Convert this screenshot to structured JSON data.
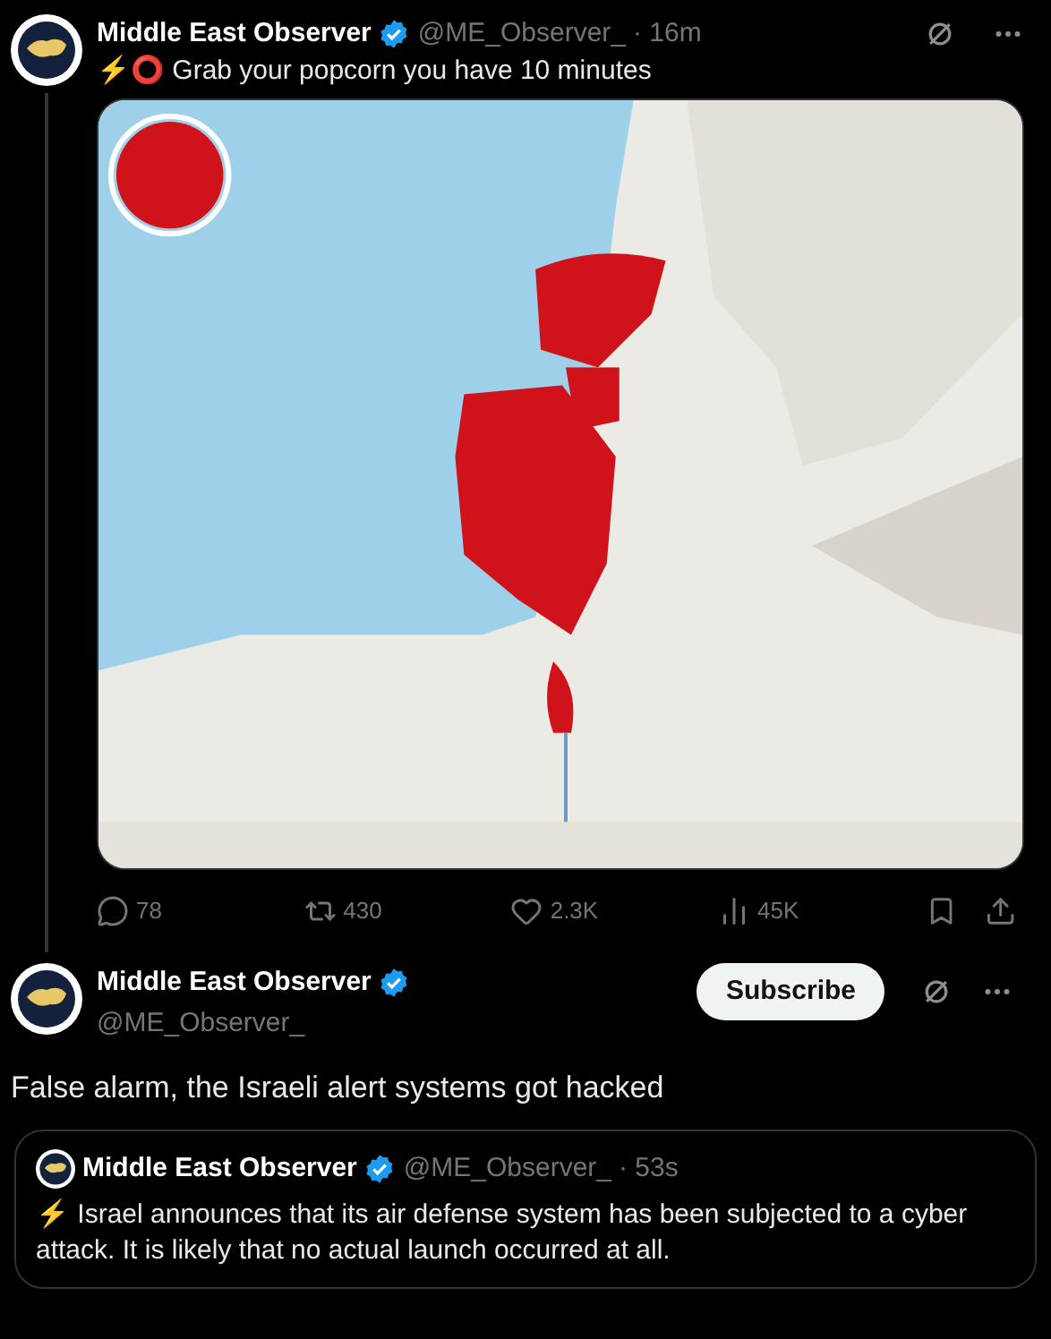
{
  "post": {
    "name": "Middle East Observer",
    "handle": "@ME_Observer_",
    "time": "· 16m",
    "verified": true,
    "text": "⚡⭕ Grab your popcorn you have 10 minutes",
    "actions": [
      {
        "kind": "reply",
        "count": "78"
      },
      {
        "kind": "repost",
        "count": "430"
      },
      {
        "kind": "like",
        "count": "2.3K"
      },
      {
        "kind": "views",
        "count": "45K"
      }
    ]
  },
  "reply": {
    "name": "Middle East Observer",
    "handle": "@ME_Observer_",
    "verified": true,
    "subscribe": "Subscribe",
    "text": "False alarm, the Israeli alert systems got hacked",
    "quote": {
      "name": "Middle East Observer",
      "handle": "@ME_Observer_",
      "time": "· 53s",
      "verified": true,
      "text": "⚡ Israel announces that its air defense system has been subjected to a cyber attack. It is likely that no actual launch occurred at all."
    }
  }
}
